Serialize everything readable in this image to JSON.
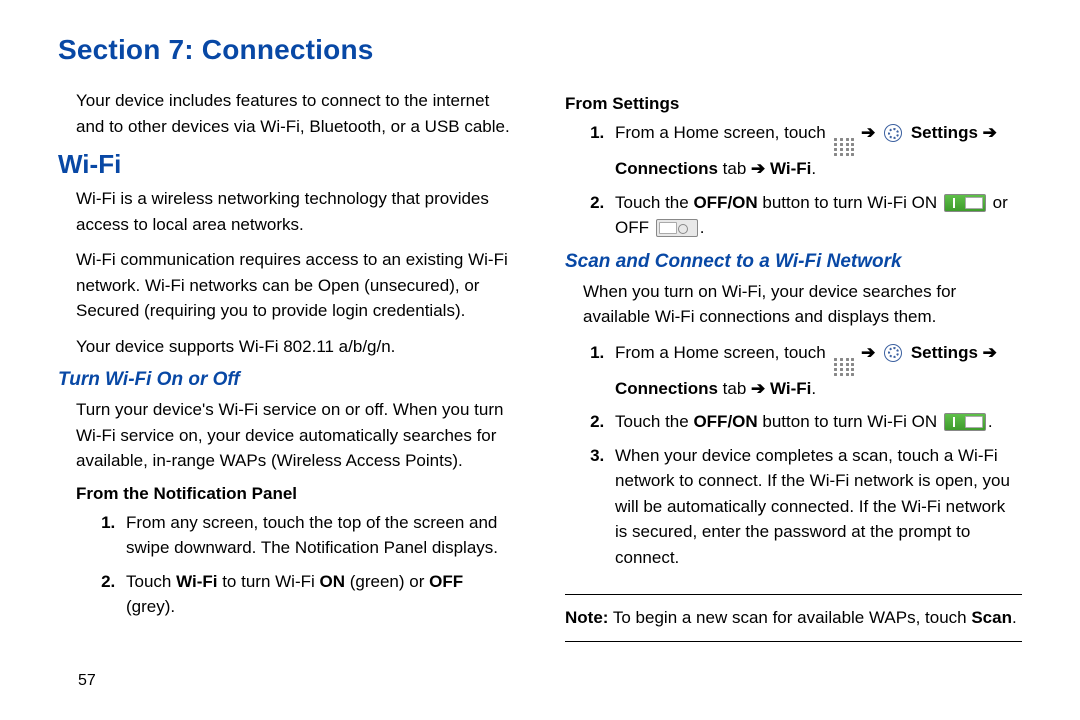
{
  "section_title": "Section 7: Connections",
  "page_number": "57",
  "left": {
    "intro": "Your device includes features to connect to the internet and to other devices via Wi-Fi, Bluetooth, or a USB cable.",
    "h2_wifi": "Wi-Fi",
    "p1": "Wi-Fi is a wireless networking technology that provides access to local area networks.",
    "p2": "Wi-Fi communication requires access to an existing Wi-Fi network. Wi-Fi networks can be Open (unsecured), or Secured (requiring you to provide login credentials).",
    "p3": "Your device supports Wi-Fi 802.11 a/b/g/n.",
    "h3_turn": "Turn Wi-Fi On or Off",
    "p4": "Turn your device's Wi-Fi service on or off. When you turn Wi-Fi service on, your device automatically searches for available, in-range WAPs (Wireless Access Points).",
    "h4_notif": "From the Notification Panel",
    "ol1_1": "From any screen, touch the top of the screen and swipe downward. The Notification Panel displays.",
    "ol1_2_a": "Touch ",
    "ol1_2_b": "Wi-Fi",
    "ol1_2_c": " to turn Wi-Fi ",
    "ol1_2_d": "ON",
    "ol1_2_e": " (green) or ",
    "ol1_2_f": "OFF",
    "ol1_2_g": " (grey)."
  },
  "right": {
    "h4_settings": "From Settings",
    "s1_a": "From a Home screen, touch ",
    "s1_arrow1": " ➔ ",
    "s1_settings": " Settings ➔ Connections",
    "s1_tab": " tab ",
    "s1_arrow2": "➔ ",
    "s1_wifi": "Wi-Fi",
    "s1_period": ".",
    "s2_a": "Touch the ",
    "s2_b": "OFF/ON",
    "s2_c": " button to turn Wi-Fi ON ",
    "s2_d": " or OFF ",
    "s2_e": ".",
    "h3_scan": "Scan and Connect to a Wi-Fi Network",
    "p_scan": "When you turn on Wi-Fi, your device searches for available Wi-Fi connections and displays them.",
    "sc2_a": "Touch the ",
    "sc2_b": "OFF/ON",
    "sc2_c": " button to turn Wi-Fi ON ",
    "sc2_d": ".",
    "sc3": "When your device completes a scan, touch a Wi-Fi network to connect. If the Wi-Fi network is open, you will be automatically connected. If the Wi-Fi network is secured, enter the password at the prompt to connect.",
    "note_a": "Note:",
    "note_b": " To begin a new scan for available WAPs, touch ",
    "note_c": "Scan",
    "note_d": "."
  }
}
